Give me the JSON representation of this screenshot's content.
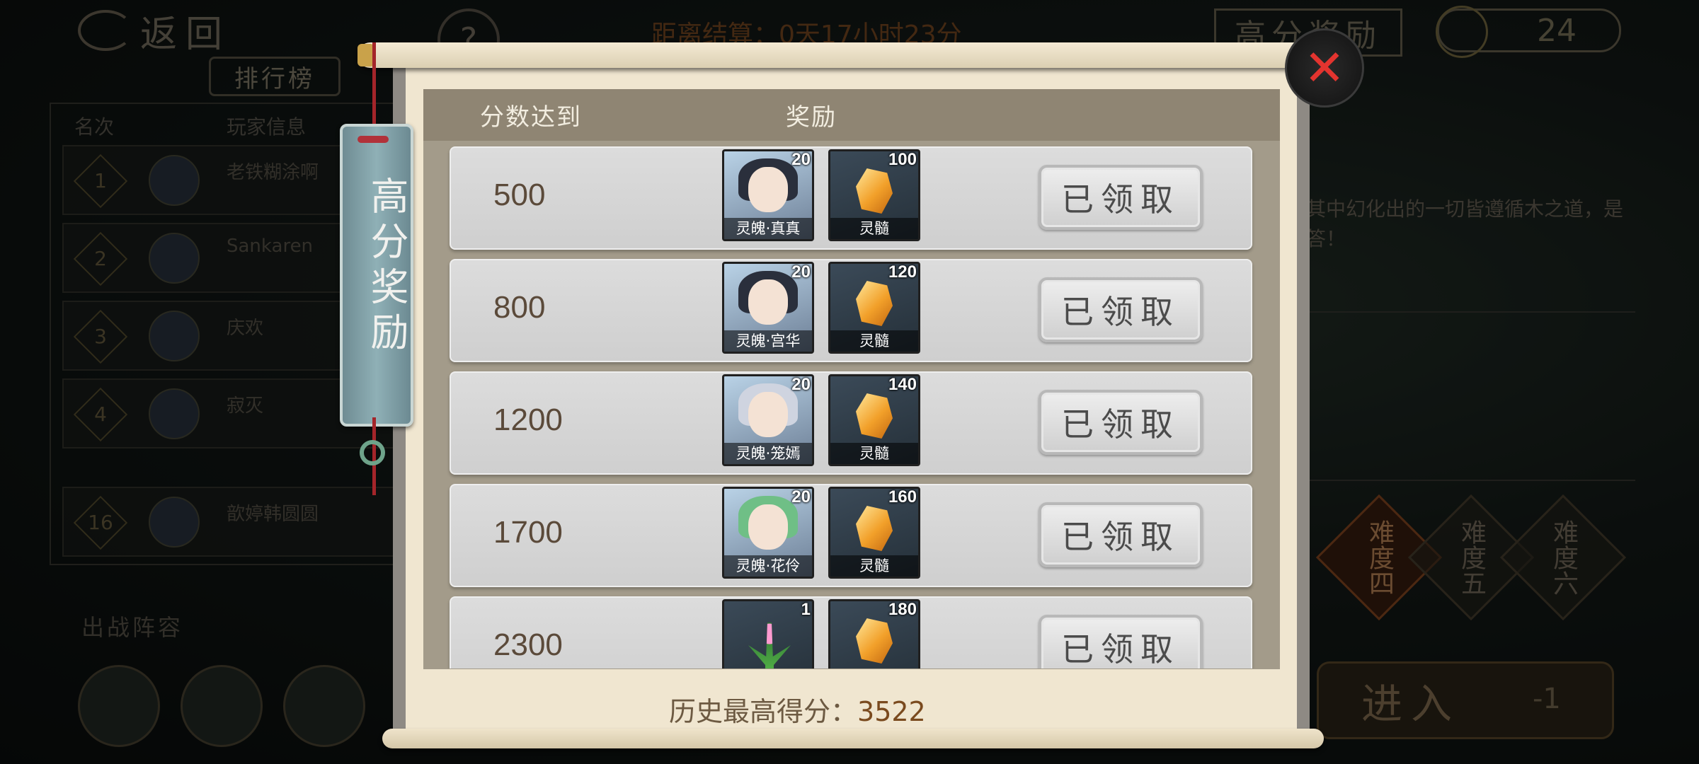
{
  "background": {
    "back_label": "返回",
    "help_label": "?",
    "ranking_tab": "排行榜",
    "timer": "距离结算：0天17小时23分",
    "high_score_tab": "高分奖励",
    "key_count": "24",
    "leaderboard": {
      "col_rank": "名次",
      "col_player": "玩家信息",
      "rows": [
        {
          "rank": "1",
          "name": "老铁糊涂啊"
        },
        {
          "rank": "2",
          "name": "Sankaren"
        },
        {
          "rank": "3",
          "name": "庆欢"
        },
        {
          "rank": "4",
          "name": "寂灭"
        },
        {
          "rank": "16",
          "name": "歆婷韩圆圆"
        }
      ]
    },
    "team_title": "出战阵容",
    "description": "其中幻化出的一切皆遵循木之道，是答！",
    "difficulties": [
      "难度四",
      "难度五",
      "难度六"
    ],
    "enter_label": "进入",
    "enter_cost": "-1"
  },
  "modal": {
    "tag_text": "高分奖励",
    "header": {
      "score": "分数达到",
      "reward": "奖励"
    },
    "rows": [
      {
        "score": "500",
        "hero_label": "灵魄·真真",
        "hero_count": "20",
        "gem_label": "灵髓",
        "gem_count": "100",
        "claim_label": "已领取"
      },
      {
        "score": "800",
        "hero_label": "灵魄·宫华",
        "hero_count": "20",
        "gem_label": "灵髓",
        "gem_count": "120",
        "claim_label": "已领取"
      },
      {
        "score": "1200",
        "hero_label": "灵魄·笼嫣",
        "hero_count": "20",
        "gem_label": "灵髓",
        "gem_count": "140",
        "claim_label": "已领取"
      },
      {
        "score": "1700",
        "hero_label": "灵魄·花伶",
        "hero_count": "20",
        "gem_label": "灵髓",
        "gem_count": "160",
        "claim_label": "已领取"
      },
      {
        "score": "2300",
        "hero_label": "",
        "hero_count": "1",
        "gem_label": "",
        "gem_count": "180",
        "claim_label": "已领取"
      }
    ],
    "history_label": "历史最高得分：",
    "history_value": "3522",
    "close_icon": "close-icon"
  }
}
